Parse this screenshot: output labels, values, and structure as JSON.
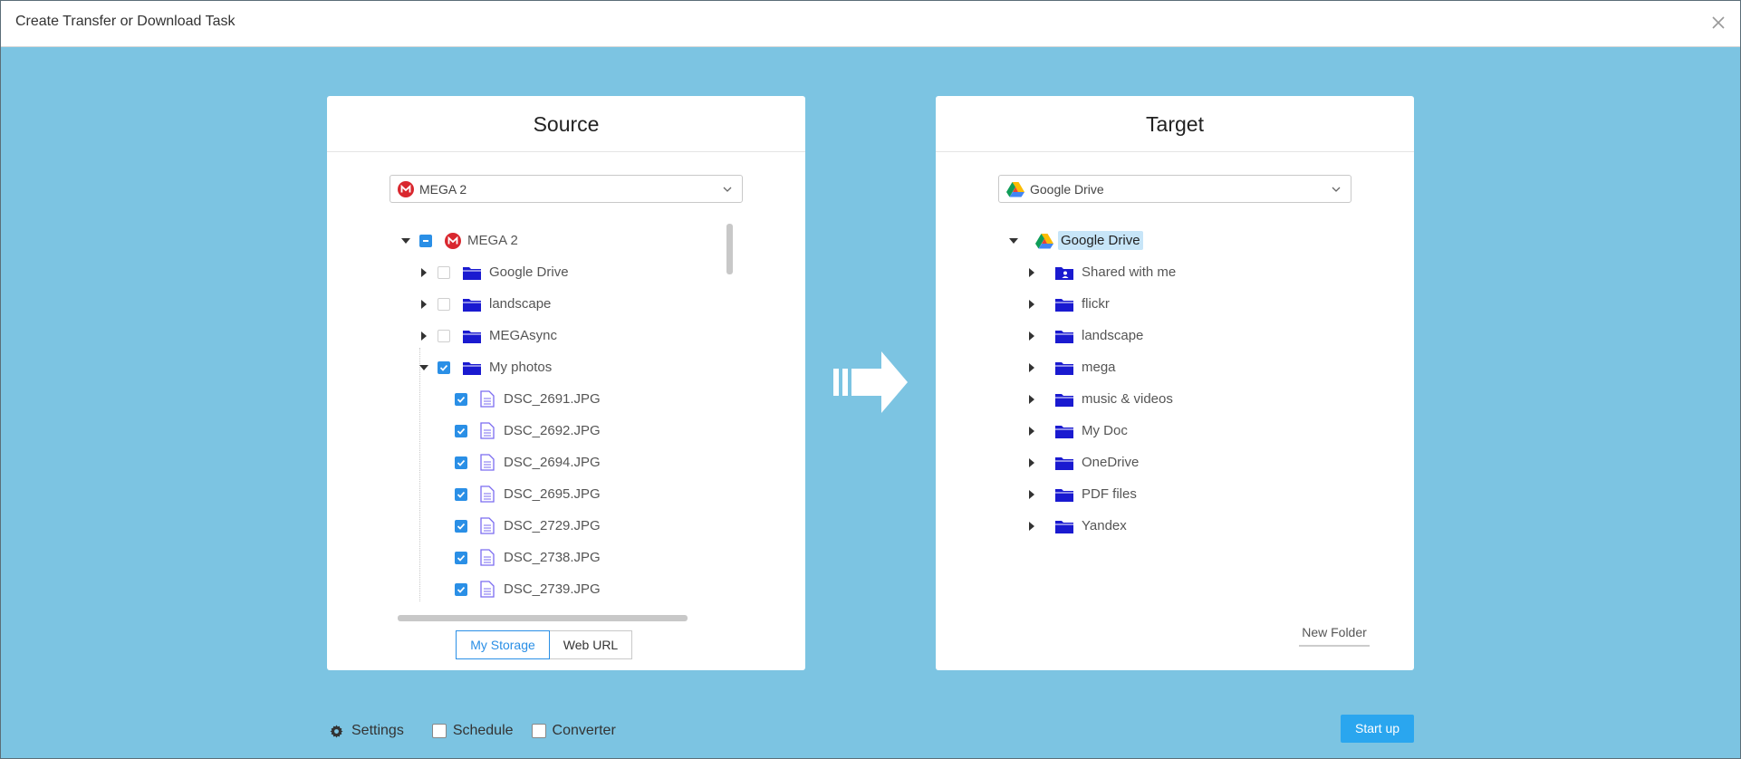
{
  "window": {
    "title": "Create Transfer or Download Task"
  },
  "source": {
    "heading": "Source",
    "selected_service": "MEGA 2",
    "tree": {
      "root": {
        "label": "MEGA 2",
        "state": "partial",
        "expanded": true
      },
      "folders": [
        {
          "label": "Google Drive",
          "checked": false,
          "expanded": false
        },
        {
          "label": "landscape",
          "checked": false,
          "expanded": false
        },
        {
          "label": "MEGAsync",
          "checked": false,
          "expanded": false
        },
        {
          "label": "My photos",
          "checked": true,
          "expanded": true
        }
      ],
      "files": [
        {
          "label": "DSC_2691.JPG",
          "checked": true
        },
        {
          "label": "DSC_2692.JPG",
          "checked": true
        },
        {
          "label": "DSC_2694.JPG",
          "checked": true
        },
        {
          "label": "DSC_2695.JPG",
          "checked": true
        },
        {
          "label": "DSC_2729.JPG",
          "checked": true
        },
        {
          "label": "DSC_2738.JPG",
          "checked": true
        },
        {
          "label": "DSC_2739.JPG",
          "checked": true
        }
      ]
    },
    "tabs": [
      {
        "label": "My Storage",
        "active": true
      },
      {
        "label": "Web URL",
        "active": false
      }
    ]
  },
  "target": {
    "heading": "Target",
    "selected_service": "Google Drive",
    "tree": {
      "root": {
        "label": "Google Drive",
        "selected": true,
        "expanded": true
      },
      "folders": [
        {
          "label": "Shared with me",
          "icon": "shared-folder-icon"
        },
        {
          "label": "flickr",
          "icon": "folder-icon"
        },
        {
          "label": "landscape",
          "icon": "folder-icon"
        },
        {
          "label": "mega",
          "icon": "folder-icon"
        },
        {
          "label": "music & videos",
          "icon": "folder-icon"
        },
        {
          "label": "My Doc",
          "icon": "folder-icon"
        },
        {
          "label": "OneDrive",
          "icon": "folder-icon"
        },
        {
          "label": "PDF files",
          "icon": "folder-icon"
        },
        {
          "label": "Yandex",
          "icon": "folder-icon"
        }
      ]
    },
    "new_folder_label": "New Folder"
  },
  "bottom": {
    "settings_label": "Settings",
    "schedule_label": "Schedule",
    "converter_label": "Converter",
    "start_label": "Start up"
  },
  "colors": {
    "background": "#7cc4e2",
    "accent": "#2a8fe6",
    "start_button": "#2aa6ef",
    "folder": "#1a1ad0",
    "mega_red": "#d9272e"
  }
}
